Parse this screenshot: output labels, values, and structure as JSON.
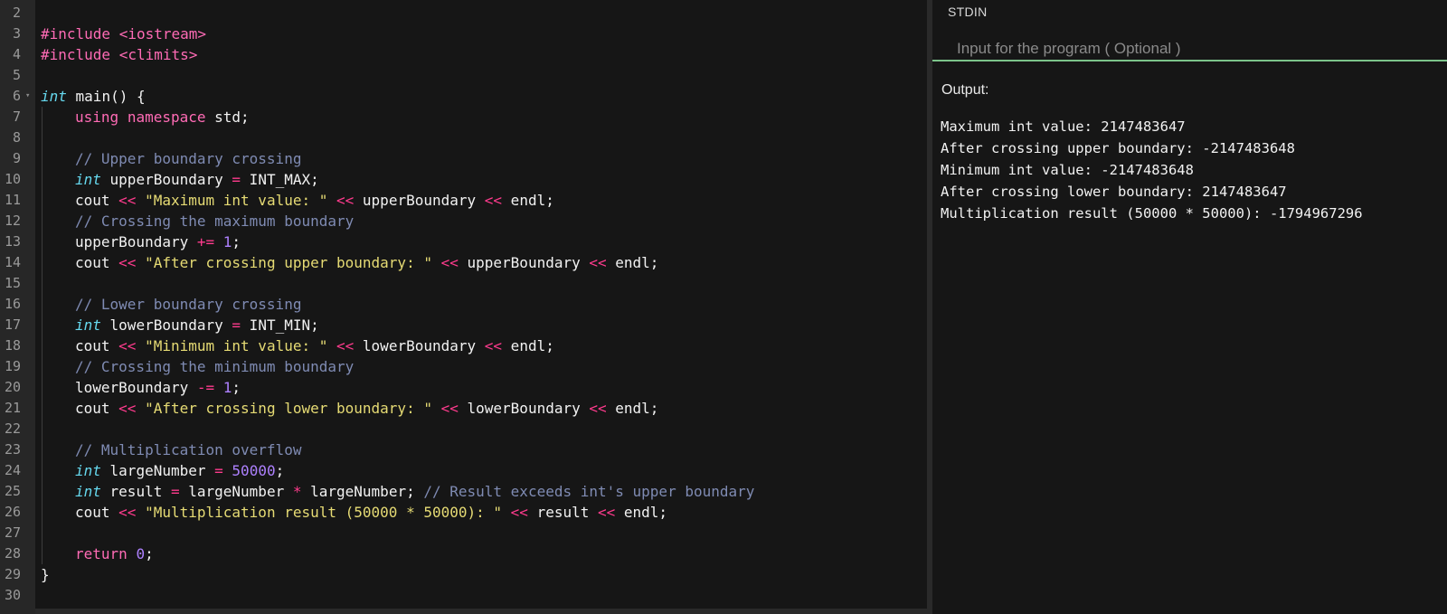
{
  "editor": {
    "lines": [
      {
        "n": "2",
        "segs": []
      },
      {
        "n": "3",
        "segs": [
          {
            "c": "inc",
            "t": "#include "
          },
          {
            "c": "inc",
            "t": "<iostream>"
          }
        ]
      },
      {
        "n": "4",
        "segs": [
          {
            "c": "inc",
            "t": "#include "
          },
          {
            "c": "inc",
            "t": "<climits>"
          }
        ]
      },
      {
        "n": "5",
        "segs": []
      },
      {
        "n": "6",
        "fold": true,
        "segs": [
          {
            "c": "tp",
            "t": "int"
          },
          {
            "c": "",
            "t": " main() {"
          }
        ]
      },
      {
        "n": "7",
        "ind": 1,
        "segs": [
          {
            "c": "kw",
            "t": "using"
          },
          {
            "c": "",
            "t": " "
          },
          {
            "c": "kw",
            "t": "namespace"
          },
          {
            "c": "",
            "t": " std;"
          }
        ]
      },
      {
        "n": "8",
        "ind": 1,
        "segs": []
      },
      {
        "n": "9",
        "ind": 1,
        "segs": [
          {
            "c": "cm",
            "t": "// Upper boundary crossing"
          }
        ]
      },
      {
        "n": "10",
        "ind": 1,
        "segs": [
          {
            "c": "tp",
            "t": "int"
          },
          {
            "c": "",
            "t": " upperBoundary "
          },
          {
            "c": "op",
            "t": "="
          },
          {
            "c": "",
            "t": " INT_MAX;"
          }
        ]
      },
      {
        "n": "11",
        "ind": 1,
        "segs": [
          {
            "c": "",
            "t": "cout "
          },
          {
            "c": "op",
            "t": "<<"
          },
          {
            "c": "",
            "t": " "
          },
          {
            "c": "str",
            "t": "\"Maximum int value: \""
          },
          {
            "c": "",
            "t": " "
          },
          {
            "c": "op",
            "t": "<<"
          },
          {
            "c": "",
            "t": " upperBoundary "
          },
          {
            "c": "op",
            "t": "<<"
          },
          {
            "c": "",
            "t": " endl;"
          }
        ]
      },
      {
        "n": "12",
        "ind": 1,
        "segs": [
          {
            "c": "cm",
            "t": "// Crossing the maximum boundary"
          }
        ]
      },
      {
        "n": "13",
        "ind": 1,
        "segs": [
          {
            "c": "",
            "t": "upperBoundary "
          },
          {
            "c": "op",
            "t": "+="
          },
          {
            "c": "",
            "t": " "
          },
          {
            "c": "num",
            "t": "1"
          },
          {
            "c": "",
            "t": ";"
          }
        ]
      },
      {
        "n": "14",
        "ind": 1,
        "segs": [
          {
            "c": "",
            "t": "cout "
          },
          {
            "c": "op",
            "t": "<<"
          },
          {
            "c": "",
            "t": " "
          },
          {
            "c": "str",
            "t": "\"After crossing upper boundary: \""
          },
          {
            "c": "",
            "t": " "
          },
          {
            "c": "op",
            "t": "<<"
          },
          {
            "c": "",
            "t": " upperBoundary "
          },
          {
            "c": "op",
            "t": "<<"
          },
          {
            "c": "",
            "t": " endl;"
          }
        ]
      },
      {
        "n": "15",
        "ind": 1,
        "segs": []
      },
      {
        "n": "16",
        "ind": 1,
        "segs": [
          {
            "c": "cm",
            "t": "// Lower boundary crossing"
          }
        ]
      },
      {
        "n": "17",
        "ind": 1,
        "segs": [
          {
            "c": "tp",
            "t": "int"
          },
          {
            "c": "",
            "t": " lowerBoundary "
          },
          {
            "c": "op",
            "t": "="
          },
          {
            "c": "",
            "t": " INT_MIN;"
          }
        ]
      },
      {
        "n": "18",
        "ind": 1,
        "segs": [
          {
            "c": "",
            "t": "cout "
          },
          {
            "c": "op",
            "t": "<<"
          },
          {
            "c": "",
            "t": " "
          },
          {
            "c": "str",
            "t": "\"Minimum int value: \""
          },
          {
            "c": "",
            "t": " "
          },
          {
            "c": "op",
            "t": "<<"
          },
          {
            "c": "",
            "t": " lowerBoundary "
          },
          {
            "c": "op",
            "t": "<<"
          },
          {
            "c": "",
            "t": " endl;"
          }
        ]
      },
      {
        "n": "19",
        "ind": 1,
        "segs": [
          {
            "c": "cm",
            "t": "// Crossing the minimum boundary"
          }
        ]
      },
      {
        "n": "20",
        "ind": 1,
        "segs": [
          {
            "c": "",
            "t": "lowerBoundary "
          },
          {
            "c": "op",
            "t": "-="
          },
          {
            "c": "",
            "t": " "
          },
          {
            "c": "num",
            "t": "1"
          },
          {
            "c": "",
            "t": ";"
          }
        ]
      },
      {
        "n": "21",
        "ind": 1,
        "segs": [
          {
            "c": "",
            "t": "cout "
          },
          {
            "c": "op",
            "t": "<<"
          },
          {
            "c": "",
            "t": " "
          },
          {
            "c": "str",
            "t": "\"After crossing lower boundary: \""
          },
          {
            "c": "",
            "t": " "
          },
          {
            "c": "op",
            "t": "<<"
          },
          {
            "c": "",
            "t": " lowerBoundary "
          },
          {
            "c": "op",
            "t": "<<"
          },
          {
            "c": "",
            "t": " endl;"
          }
        ]
      },
      {
        "n": "22",
        "ind": 1,
        "segs": []
      },
      {
        "n": "23",
        "ind": 1,
        "segs": [
          {
            "c": "cm",
            "t": "// Multiplication overflow"
          }
        ]
      },
      {
        "n": "24",
        "ind": 1,
        "segs": [
          {
            "c": "tp",
            "t": "int"
          },
          {
            "c": "",
            "t": " largeNumber "
          },
          {
            "c": "op",
            "t": "="
          },
          {
            "c": "",
            "t": " "
          },
          {
            "c": "num",
            "t": "50000"
          },
          {
            "c": "",
            "t": ";"
          }
        ]
      },
      {
        "n": "25",
        "ind": 1,
        "segs": [
          {
            "c": "tp",
            "t": "int"
          },
          {
            "c": "",
            "t": " result "
          },
          {
            "c": "op",
            "t": "="
          },
          {
            "c": "",
            "t": " largeNumber "
          },
          {
            "c": "op",
            "t": "*"
          },
          {
            "c": "",
            "t": " largeNumber; "
          },
          {
            "c": "cm",
            "t": "// Result exceeds int's upper boundary"
          }
        ]
      },
      {
        "n": "26",
        "ind": 1,
        "segs": [
          {
            "c": "",
            "t": "cout "
          },
          {
            "c": "op",
            "t": "<<"
          },
          {
            "c": "",
            "t": " "
          },
          {
            "c": "str",
            "t": "\"Multiplication result (50000 * 50000): \""
          },
          {
            "c": "",
            "t": " "
          },
          {
            "c": "op",
            "t": "<<"
          },
          {
            "c": "",
            "t": " result "
          },
          {
            "c": "op",
            "t": "<<"
          },
          {
            "c": "",
            "t": " endl;"
          }
        ]
      },
      {
        "n": "27",
        "ind": 1,
        "segs": []
      },
      {
        "n": "28",
        "ind": 1,
        "segs": [
          {
            "c": "kw",
            "t": "return"
          },
          {
            "c": "",
            "t": " "
          },
          {
            "c": "num",
            "t": "0"
          },
          {
            "c": "",
            "t": ";"
          }
        ]
      },
      {
        "n": "29",
        "segs": [
          {
            "c": "",
            "t": "}"
          }
        ]
      },
      {
        "n": "30",
        "segs": []
      }
    ]
  },
  "stdin": {
    "label": "STDIN",
    "placeholder": "Input for the program ( Optional )"
  },
  "output": {
    "label": "Output:",
    "lines": [
      "Maximum int value: 2147483647",
      "After crossing upper boundary: -2147483648",
      "Minimum int value: -2147483648",
      "After crossing lower boundary: 2147483647",
      "Multiplication result (50000 * 50000): -1794967296"
    ]
  },
  "colors": {
    "background": "#161616",
    "gutter": "#272727",
    "accent_underline": "#7cc48a",
    "keyword": "#ff6bb5",
    "type": "#66d9ef",
    "string": "#e6db74",
    "number": "#ae81ff",
    "comment": "#7f8bb3"
  }
}
